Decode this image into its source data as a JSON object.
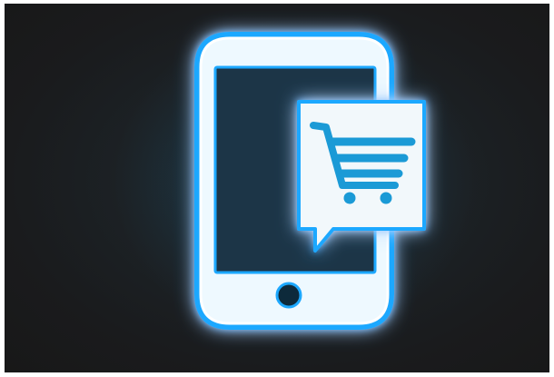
{
  "image": {
    "subject": "phone-with-shopping-cart-message-icon",
    "style": "neon-glow",
    "colors": {
      "background": "#1a1b1d",
      "frame_border": "#ffffff",
      "neon_glow": "#1ea8ff",
      "neon_core": "#eaf8ff",
      "icon_fill": "#f2f8fb",
      "cart_color": "#1b9ad6"
    },
    "icons": [
      "smartphone-icon",
      "chat-bubble-icon",
      "shopping-cart-icon",
      "home-button-icon"
    ]
  }
}
